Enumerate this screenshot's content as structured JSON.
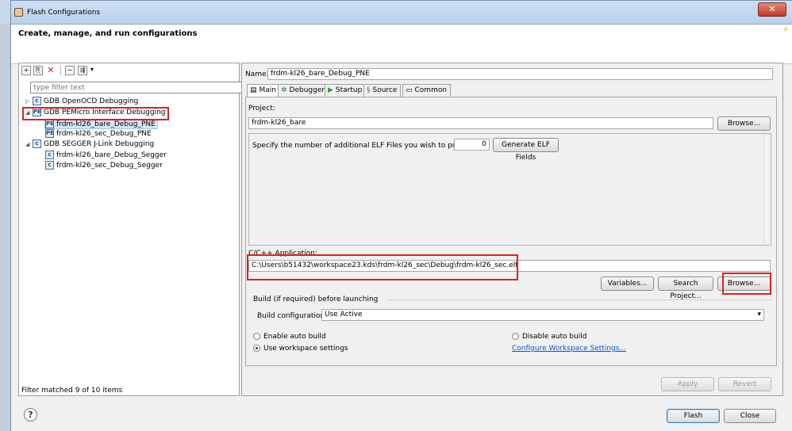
{
  "window": {
    "title": "Flash Configurations",
    "header_title": "Create, manage, and run configurations"
  },
  "left": {
    "filter_placeholder": "type filter text",
    "tree": [
      {
        "label": "GDB OpenOCD Debugging",
        "icon": "c-config-icon"
      },
      {
        "label": "GDB PEMicro Interface Debugging",
        "icon": "pe-config-icon"
      },
      {
        "label": "frdm-kl26_bare_Debug_PNE",
        "icon": "pe-config-icon"
      },
      {
        "label": "frdm-kl26_sec_Debug_PNE",
        "icon": "pe-config-icon"
      },
      {
        "label": "GDB SEGGER J-Link Debugging",
        "icon": "c-config-icon"
      },
      {
        "label": "frdm-kl26_bare_Debug_Segger",
        "icon": "c-config-icon"
      },
      {
        "label": "frdm-kl26_sec_Debug_Segger",
        "icon": "c-config-icon"
      }
    ],
    "status": "Filter matched 9 of 10 items"
  },
  "right": {
    "name_label": "Name:",
    "name_value": "frdm-kl26_bare_Debug_PNE",
    "tabs": [
      {
        "label": "Main",
        "icon": "main-tab-icon"
      },
      {
        "label": "Debugger",
        "icon": "debugger-tab-icon"
      },
      {
        "label": "Startup",
        "icon": "startup-tab-icon"
      },
      {
        "label": "Source",
        "icon": "source-tab-icon"
      },
      {
        "label": "Common",
        "icon": "common-tab-icon"
      }
    ],
    "project_label": "Project:",
    "project_value": "frdm-kl26_bare",
    "browse1": "Browse...",
    "elf_label": "Specify the number of additional ELF Files you wish to program:",
    "elf_count": "0",
    "generate_elf": "Generate ELF Fields",
    "app_label": "C/C++ Application:",
    "app_value": "C:\\Users\\b51432\\workspace23.kds\\frdm-kl26_sec\\Debug\\frdm-kl26_sec.elf",
    "variables": "Variables...",
    "search_project": "Search Project...",
    "browse2": "Browse...",
    "build_group": "Build (if required) before launching",
    "build_config_label": "Build configuration:",
    "build_config_value": "Use Active",
    "enable_auto": "Enable auto build",
    "disable_auto": "Disable auto build",
    "use_workspace": "Use workspace settings",
    "configure_ws": "Configure Workspace Settings...",
    "apply": "Apply",
    "revert": "Revert"
  },
  "footer": {
    "help": "?",
    "flash": "Flash",
    "close": "Close"
  },
  "colors": {
    "highlight_box": "#e02020",
    "link": "#0a58c9",
    "selection": "#d6e4f5"
  }
}
